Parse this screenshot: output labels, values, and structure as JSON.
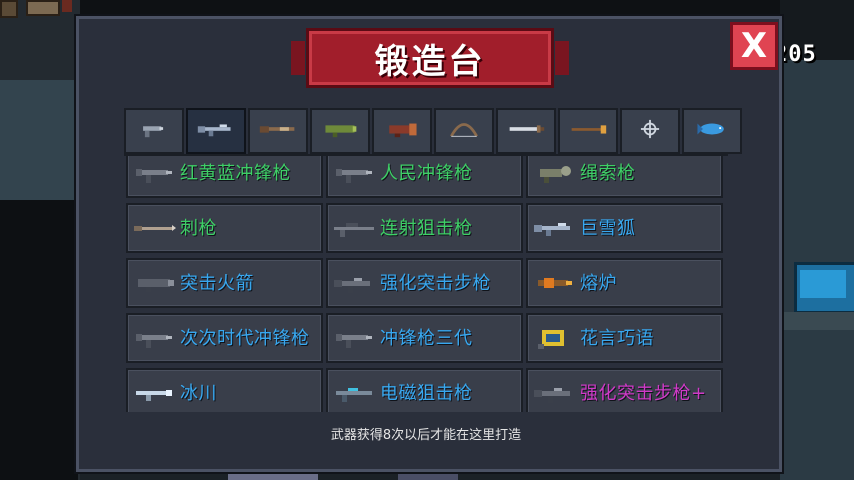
{
  "title": "锻造台",
  "counter": "205",
  "close_label": "X",
  "tabs": [
    {
      "name": "pistol-icon"
    },
    {
      "name": "rifle-icon"
    },
    {
      "name": "shotgun-icon"
    },
    {
      "name": "launcher-icon"
    },
    {
      "name": "cannon-icon"
    },
    {
      "name": "bow-icon"
    },
    {
      "name": "sword-icon"
    },
    {
      "name": "staff-icon"
    },
    {
      "name": "crosshair-icon"
    },
    {
      "name": "fish-icon"
    }
  ],
  "selected_tab": 1,
  "weapons": [
    {
      "label": "红黄蓝冲锋枪",
      "color": "green",
      "icon": "smg-icon"
    },
    {
      "label": "人民冲锋枪",
      "color": "green",
      "icon": "smg-icon"
    },
    {
      "label": "绳索枪",
      "color": "green",
      "icon": "grapple-icon"
    },
    {
      "label": "刺枪",
      "color": "green",
      "icon": "spear-gun-icon"
    },
    {
      "label": "连射狙击枪",
      "color": "green",
      "icon": "sniper-icon"
    },
    {
      "label": "巨雪狐",
      "color": "blue",
      "icon": "rifle-icon"
    },
    {
      "label": "突击火箭",
      "color": "blue",
      "icon": "rocket-icon"
    },
    {
      "label": "强化突击步枪",
      "color": "blue",
      "icon": "assault-rifle-icon"
    },
    {
      "label": "熔炉",
      "color": "blue",
      "icon": "furnace-gun-icon"
    },
    {
      "label": "次次时代冲锋枪",
      "color": "blue",
      "icon": "smg-icon"
    },
    {
      "label": "冲锋枪三代",
      "color": "blue",
      "icon": "smg-icon"
    },
    {
      "label": "花言巧语",
      "color": "blue",
      "icon": "cube-gun-icon"
    },
    {
      "label": "冰川",
      "color": "blue",
      "icon": "ice-gun-icon"
    },
    {
      "label": "电磁狙击枪",
      "color": "blue",
      "icon": "railgun-icon"
    },
    {
      "label": "强化突击步枪+",
      "color": "purple",
      "icon": "assault-rifle-icon"
    }
  ],
  "footer_note": "武器获得8次以后才能在这里打造",
  "colors": {
    "green": "#3ecf66",
    "blue": "#38a8f0",
    "purple": "#d03ac8",
    "banner": "#a11e2b",
    "close": "#e04452"
  }
}
